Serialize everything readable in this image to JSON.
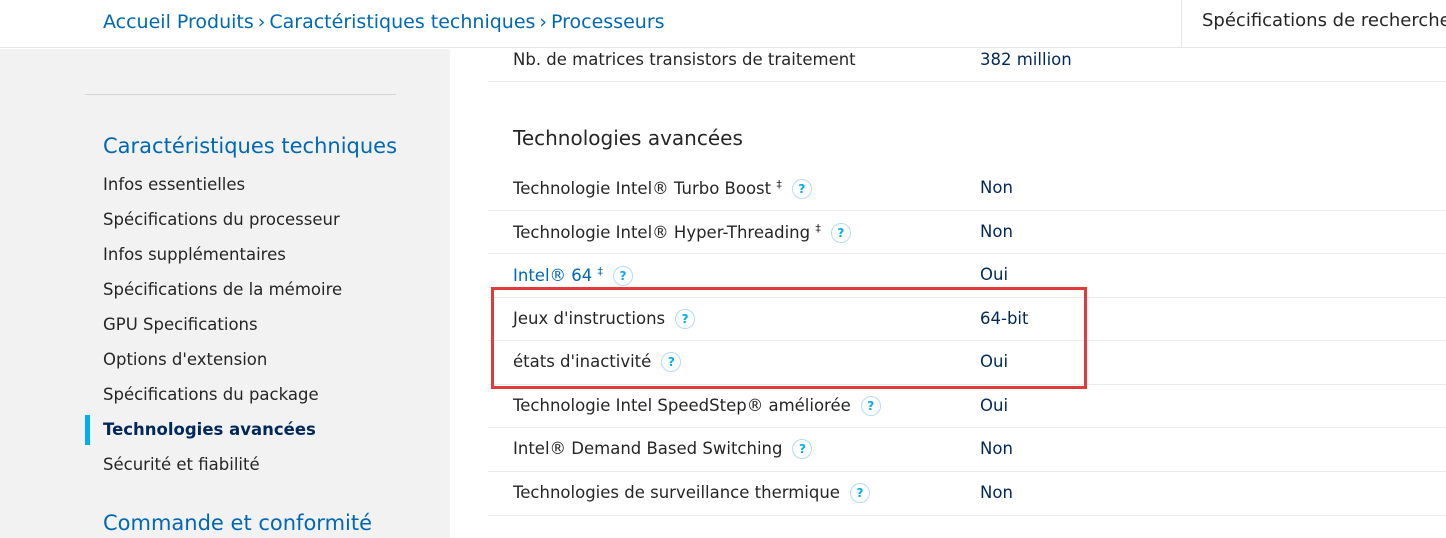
{
  "breadcrumb": {
    "items": [
      "Accueil Produits",
      "Caractéristiques techniques",
      "Processeurs"
    ],
    "separator": "›"
  },
  "search_specs_label": "Spécifications de recherche",
  "sidebar": {
    "section_title": "Caractéristiques techniques",
    "items": [
      {
        "label": "Infos essentielles",
        "active": false
      },
      {
        "label": "Spécifications du processeur",
        "active": false
      },
      {
        "label": "Infos supplémentaires",
        "active": false
      },
      {
        "label": "Spécifications de la mémoire",
        "active": false
      },
      {
        "label": "GPU Specifications",
        "active": false
      },
      {
        "label": "Options d'extension",
        "active": false
      },
      {
        "label": "Spécifications du package",
        "active": false
      },
      {
        "label": "Technologies avancées",
        "active": true
      },
      {
        "label": "Sécurité et fiabilité",
        "active": false
      }
    ],
    "next_section_title": "Commande et conformité"
  },
  "content": {
    "top_row": {
      "label": "Nb. de matrices transistors de traitement",
      "value": "382 million"
    },
    "section_heading": "Technologies avancées",
    "rows": [
      {
        "label": "Technologie Intel® Turbo Boost",
        "dagger": "‡",
        "value": "Non"
      },
      {
        "label": "Technologie Intel® Hyper-Threading",
        "dagger": "‡",
        "value": "Non"
      },
      {
        "label": "Intel® 64",
        "dagger": "‡",
        "value": "Oui"
      },
      {
        "label": "Jeux d'instructions",
        "value": "64-bit"
      },
      {
        "label": "états d'inactivité",
        "value": "Oui"
      },
      {
        "label": "Technologie Intel SpeedStep® améliorée",
        "value": "Oui"
      },
      {
        "label": "Intel® Demand Based Switching",
        "value": "Non"
      },
      {
        "label": "Technologies de surveillance thermique",
        "value": "Non"
      }
    ],
    "help_glyph": "?"
  },
  "colors": {
    "link_blue": "#0068b5",
    "value_navy": "#00285a",
    "accent_cyan": "#00aeef",
    "highlight_red": "#e03b3b",
    "sidebar_bg": "#f2f2f2"
  }
}
